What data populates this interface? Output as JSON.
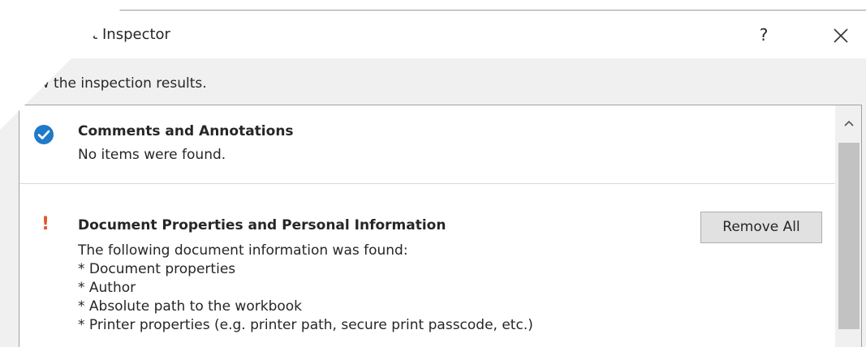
{
  "dialog": {
    "title": "Document Inspector",
    "help_label": "?",
    "subtitle": "Review the inspection results."
  },
  "results": [
    {
      "status": "ok",
      "icon": "check-circle-icon",
      "title": "Comments and Annotations",
      "lines": [
        "No items were found."
      ]
    },
    {
      "status": "warning",
      "icon": "exclamation-icon",
      "title": "Document Properties and Personal Information",
      "lines": [
        "The following document information was found:",
        "* Document properties",
        "* Author",
        "* Absolute path to the workbook",
        "* Printer properties (e.g. printer path, secure print passcode, etc.)"
      ],
      "action_label": "Remove All"
    }
  ],
  "colors": {
    "check": "#1f7ac9",
    "warning": "#e0582a"
  },
  "help_icon": "?"
}
